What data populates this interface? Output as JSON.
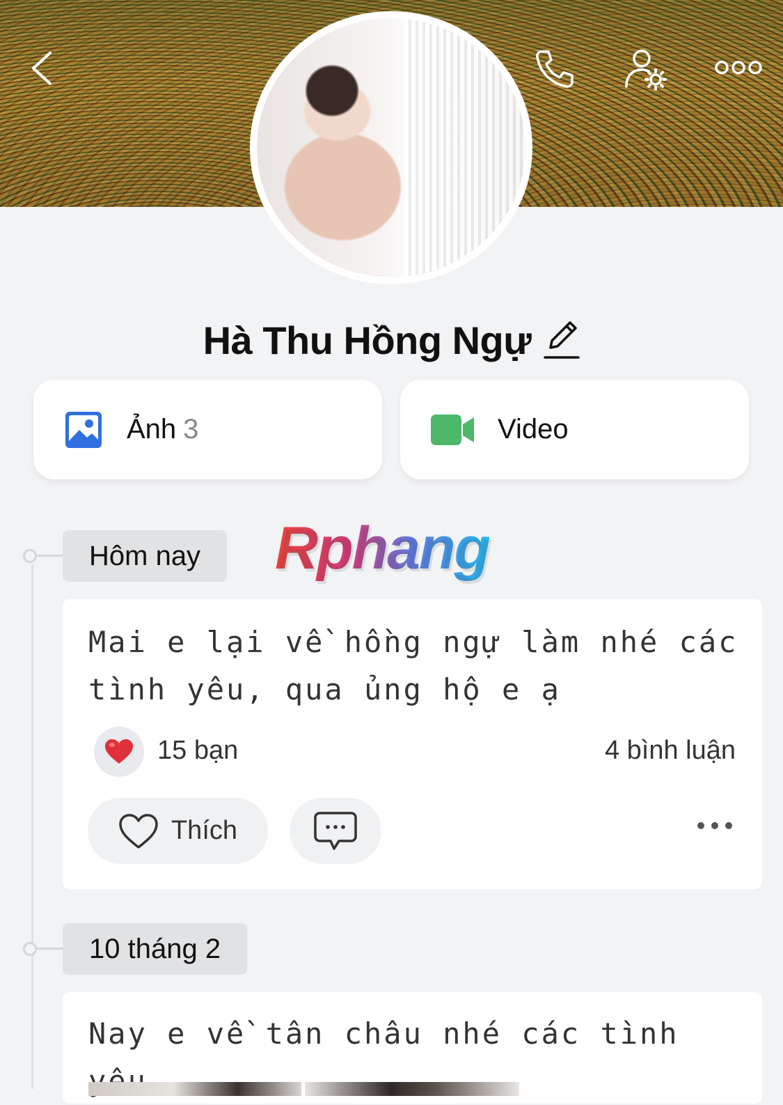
{
  "header": {
    "back_icon": "chevron-left-icon",
    "call_icon": "phone-icon",
    "settings_icon": "user-settings-icon",
    "more_icon": "more-horizontal-icon"
  },
  "profile": {
    "name": "Hà Thu Hồng Ngự",
    "edit_icon": "pencil-icon"
  },
  "media": {
    "photos": {
      "label": "Ảnh",
      "count": "3",
      "icon": "image-icon",
      "color": "#2f6fe0"
    },
    "videos": {
      "label": "Video",
      "icon": "video-camera-icon",
      "color": "#4cb86a"
    }
  },
  "watermark": "Rphang",
  "timeline": [
    {
      "date": "Hôm nay",
      "post": {
        "text": "Mai e lại về hồng ngự làm nhé các tình yêu, qua ủng hộ e ạ",
        "reaction_icon": "heart-icon",
        "likes": "15 bạn",
        "comments": "4 bình luận",
        "like_label": "Thích"
      }
    },
    {
      "date": "10 tháng 2",
      "post": {
        "text": "Nay e về tân châu nhé các tình yêu"
      }
    }
  ]
}
